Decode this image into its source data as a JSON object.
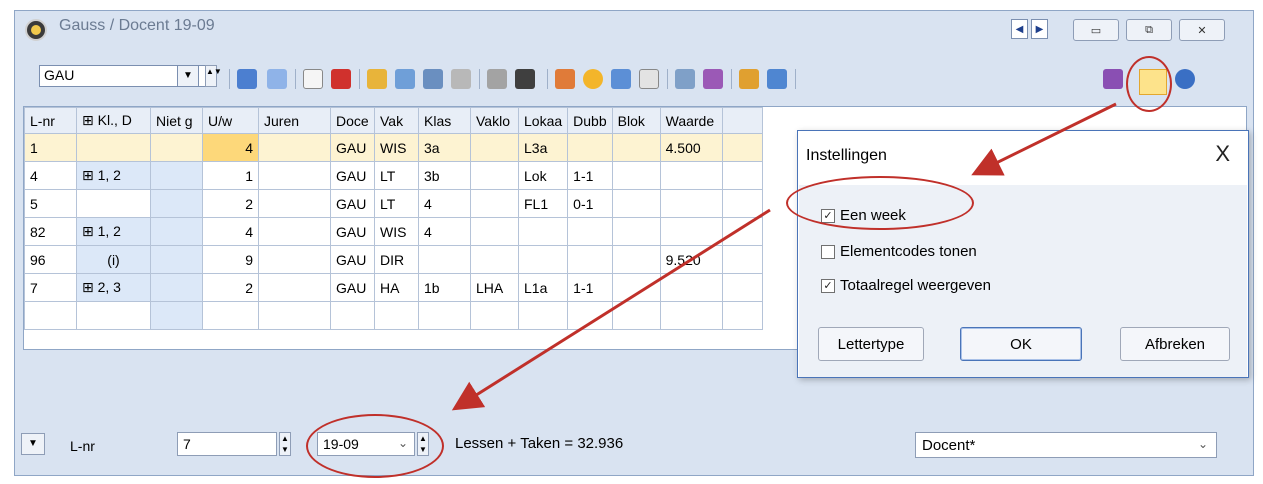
{
  "window": {
    "title": "Gauss / Docent  19-09",
    "nav_prev": "◀",
    "nav_next": "▶",
    "minimize": "▭",
    "restore": "⧉",
    "close": "✕"
  },
  "toolbar": {
    "element_value": "GAU",
    "dropdown_arrow": "▼",
    "icons": [
      "plus-grid-icon",
      "list-icon",
      "new-icon",
      "delete-icon",
      "report-icon",
      "filter-icon",
      "sort-icon",
      "link-icon",
      "wand-icon",
      "teacher-icon",
      "cycle-icon",
      "clock-icon",
      "calendar-icon",
      "grid-icon",
      "search-icon",
      "users-icon",
      "copy-icon",
      "window-icon",
      "pencil-icon",
      "settings-small-icon",
      "settings-icon",
      "help-icon"
    ],
    "accent_color": "#c0302a"
  },
  "grid": {
    "columns": [
      "L-nr",
      "⊞ Kl., D",
      "Niet g",
      "U/w",
      "Juren",
      "Doce",
      "Vak",
      "Klas",
      "Vaklo",
      "Lokaa",
      "Dubb",
      "Blok",
      "Waarde"
    ],
    "rows": [
      {
        "lnr": "1",
        "kl": "",
        "niet": "",
        "uw": "4",
        "juren": "",
        "doc": "GAU",
        "vak": "WIS",
        "klas": "3a",
        "vaklo": "",
        "lokaal": "L3a",
        "dubb": "",
        "blok": "",
        "waarde": "4.500"
      },
      {
        "lnr": "4",
        "kl": "⊞ 1, 2",
        "niet": "",
        "uw": "1",
        "juren": "",
        "doc": "GAU",
        "vak": "LT",
        "klas": "3b",
        "vaklo": "",
        "lokaal": "Lok",
        "dubb": "1-1",
        "blok": "",
        "waarde": ""
      },
      {
        "lnr": "5",
        "kl": "",
        "niet": "",
        "uw": "2",
        "juren": "",
        "doc": "GAU",
        "vak": "LT",
        "klas": "4",
        "vaklo": "",
        "lokaal": "FL1",
        "dubb": "0-1",
        "blok": "",
        "waarde": ""
      },
      {
        "lnr": "82",
        "kl": "⊞ 1, 2",
        "niet": "",
        "uw": "4",
        "juren": "",
        "doc": "GAU",
        "vak": "WIS",
        "klas": "4",
        "vaklo": "",
        "lokaal": "",
        "dubb": "",
        "blok": "",
        "waarde": ""
      },
      {
        "lnr": "96",
        "kl": "(i)",
        "niet": "",
        "uw": "9",
        "juren": "",
        "doc": "GAU",
        "vak": "DIR",
        "klas": "",
        "vaklo": "",
        "lokaal": "",
        "dubb": "",
        "blok": "",
        "waarde": "9.520"
      },
      {
        "lnr": "7",
        "kl": "⊞ 2, 3",
        "niet": "",
        "uw": "2",
        "juren": "",
        "doc": "GAU",
        "vak": "HA",
        "klas": "1b",
        "vaklo": "LHA",
        "lokaal": "L1a",
        "dubb": "1-1",
        "blok": "",
        "waarde": ""
      }
    ]
  },
  "status": {
    "field_label": "L-nr",
    "lnr_value": "7",
    "week_value": "19-09",
    "totals": "Lessen + Taken = 32.936",
    "view_value": "Docent*"
  },
  "dialog": {
    "title": "Instellingen",
    "close": "X",
    "options": [
      {
        "label": "Een week",
        "checked": true
      },
      {
        "label": "Elementcodes tonen",
        "checked": false
      },
      {
        "label": "Totaalregel weergeven",
        "checked": true
      }
    ],
    "buttons": {
      "font": "Lettertype",
      "ok": "OK",
      "cancel": "Afbreken"
    }
  }
}
